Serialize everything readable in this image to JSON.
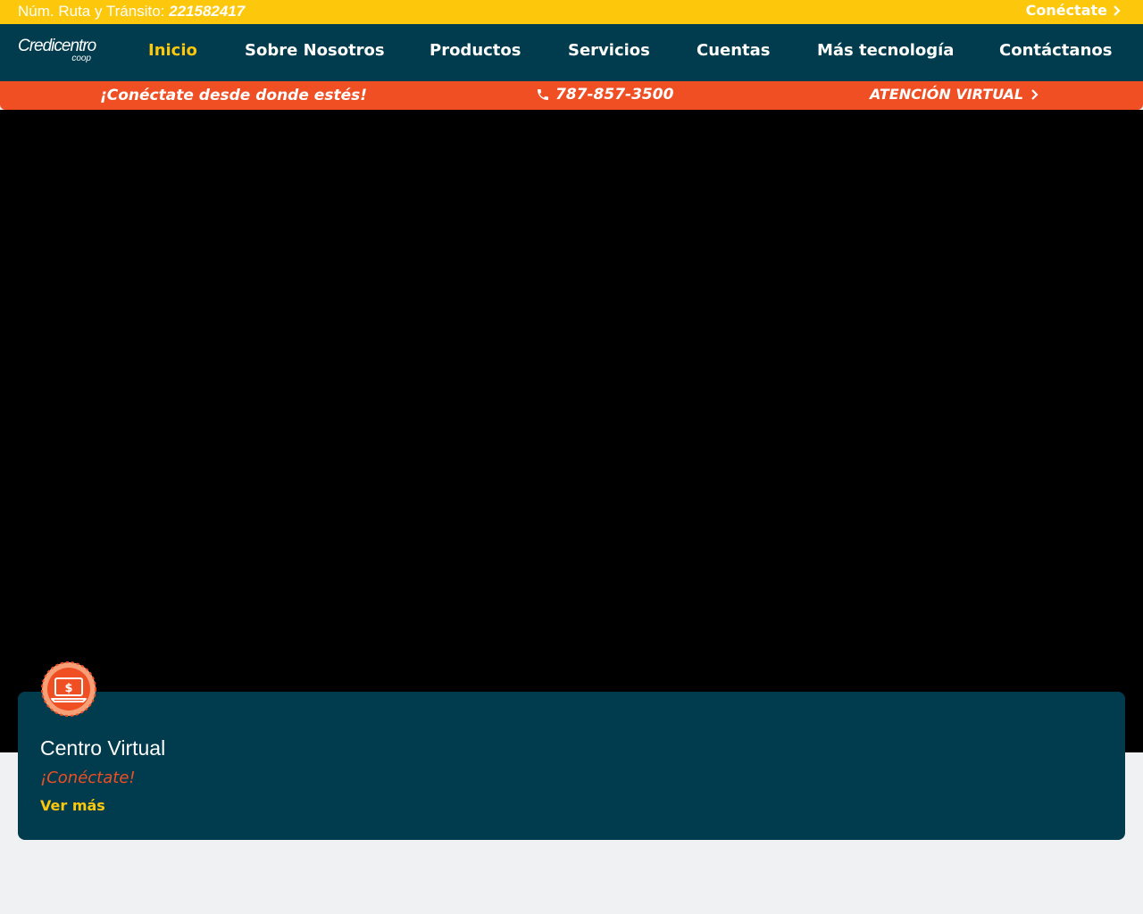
{
  "topbar": {
    "routing_label": "Núm. Ruta y Tránsito:",
    "routing_number": "221582417",
    "connect_label": "Conéctate",
    "connect_icon": "chevron-right-icon"
  },
  "logo": {
    "brand": "Credicentro",
    "suffix": "coop"
  },
  "nav": {
    "items": [
      {
        "label": "Inicio",
        "active": true
      },
      {
        "label": "Sobre Nosotros",
        "active": false
      },
      {
        "label": "Productos",
        "active": false
      },
      {
        "label": "Servicios",
        "active": false
      },
      {
        "label": "Cuentas",
        "active": false
      },
      {
        "label": "Más tecnología",
        "active": false
      },
      {
        "label": "Contáctanos",
        "active": false
      }
    ]
  },
  "infobar": {
    "tagline": "¡Conéctate desde donde estés!",
    "phone": "787-857-3500",
    "phone_icon": "phone-icon",
    "virtual_label": "ATENCIÓN VIRTUAL",
    "virtual_icon": "chevron-right-icon"
  },
  "card": {
    "icon": "laptop-dollar-icon",
    "title": "Centro Virtual",
    "subtitle": "¡Conéctate!",
    "link": "Ver más"
  },
  "colors": {
    "yellow": "#fdc70c",
    "navy": "#003c4e",
    "orange": "#f04e23",
    "page_bg": "#f0f1f3"
  }
}
